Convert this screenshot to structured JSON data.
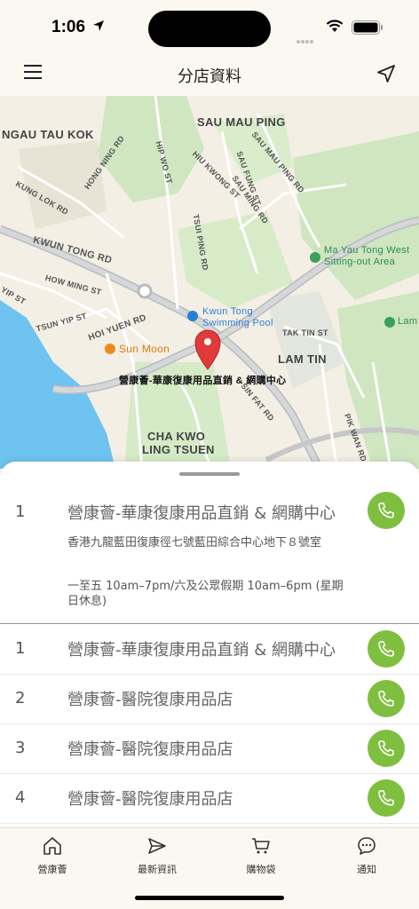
{
  "status_bar": {
    "time": "1:06"
  },
  "nav": {
    "title": "分店資料",
    "menu_icon": "hamburger-menu-icon",
    "location_icon": "location-arrow-icon"
  },
  "map": {
    "labels": {
      "ngau_tau_kok": "NGAU TAU KOK",
      "sau_mau_ping": "SAU MAU PING",
      "kwun_tong_rd": "KWUN TONG RD",
      "hong_ning_rd": "HONG NING RD",
      "kung_lok_rd": "KUNG LOK RD",
      "hip_wo_st": "HIP WO ST",
      "hiu_kwong_st": "HIU KWONG ST",
      "sau_ming_rd": "SAU MING RD",
      "sau_mau_ping_rd": "SAU MAU PING RD",
      "sau_fung_st": "SAU FUNG ST",
      "tsui_ping_rd": "TSUI PING RD",
      "how_ming_st": "HOW MING ST",
      "yip_st": "YIP ST",
      "tsun_yip_st": "TSUN YIP ST",
      "hoi_yuen_rd": "HOI YUEN RD",
      "tak_tin_st": "TAK TIN ST",
      "lam_tin": "LAM TIN",
      "sin_fat_rd": "SIN FAT RD",
      "pik_wan_rd": "PIK WAN RD",
      "cha_kwo_ling_tsuen_1": "CHA KWO",
      "cha_kwo_ling_tsuen_2": "LING TSUEN",
      "ma_yau_tong_1": "Ma Yau Tong West",
      "ma_yau_tong_2": "Sitting-out Area",
      "pool_1": "Kwun Tong",
      "pool_2": "Swimming Pool",
      "sun_moon": "Sun Moon",
      "lam_park": "Lam",
      "pin_label": "營康薈-華康復康用品直銷 & 網購中心"
    }
  },
  "selected_store": {
    "index": "1",
    "name": "營康薈-華康復康用品直銷 & 網購中心",
    "address": "香港九龍藍田復康徑七號藍田綜合中心地下８號室",
    "hours": "一至五 10am–7pm/六及公眾假期 10am–6pm (星期日休息)"
  },
  "stores": [
    {
      "index": "1",
      "name": "營康薈-華康復康用品直銷 & 網購中心"
    },
    {
      "index": "2",
      "name": "營康薈-醫院復康用品店"
    },
    {
      "index": "3",
      "name": "營康薈-醫院復康用品店"
    },
    {
      "index": "4",
      "name": "營康薈-醫院復康用品店"
    }
  ],
  "tabs": [
    {
      "label": "營康薈",
      "icon": "home-icon"
    },
    {
      "label": "最新資訊",
      "icon": "send-icon"
    },
    {
      "label": "購物袋",
      "icon": "cart-icon"
    },
    {
      "label": "通知",
      "icon": "chat-bubble-icon"
    }
  ],
  "colors": {
    "accent_green": "#7fbf3f",
    "background": "#fbf8f2",
    "water": "#6ec3f0",
    "pin": "#e03a3a"
  }
}
